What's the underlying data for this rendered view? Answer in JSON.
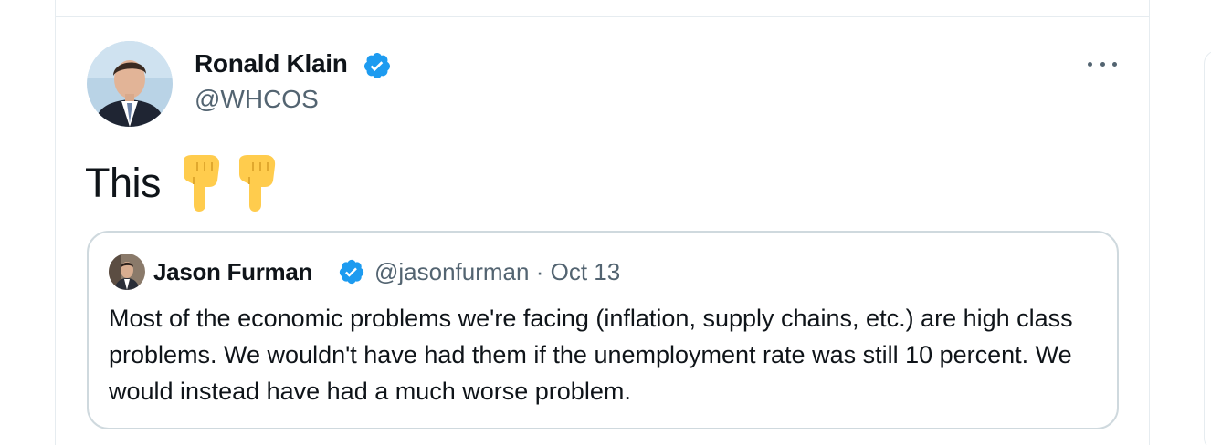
{
  "tweet": {
    "author": {
      "name": "Ronald Klain",
      "handle": "@WHCOS",
      "verified": true
    },
    "text": "This",
    "emoji": [
      "backhand-index-pointing-down",
      "backhand-index-pointing-down"
    ],
    "quoted": {
      "author": {
        "name": "Jason Furman",
        "handle": "@jasonfurman",
        "verified": true
      },
      "separator": "·",
      "date": "Oct 13",
      "text": "Most of the economic problems we're facing (inflation, supply chains, etc.) are high class problems. We wouldn't have had them if the unemployment rate was still 10 percent. We would instead have had a much worse problem."
    }
  },
  "colors": {
    "verified": "#1d9bf0",
    "secondary_text": "#536471",
    "border": "#cfd9de",
    "emoji_yellow": "#ffcc4d"
  },
  "icons": [
    "verified-badge-icon",
    "more-options-icon"
  ]
}
